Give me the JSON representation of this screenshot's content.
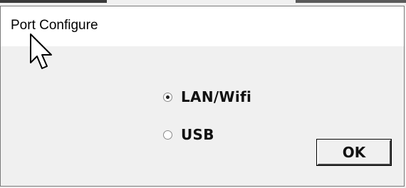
{
  "dialog": {
    "title": "Port Configure"
  },
  "options": {
    "lan_label": "LAN/Wifi",
    "usb_label": "USB",
    "selected": "LAN/Wifi"
  },
  "buttons": {
    "ok_label": "OK"
  },
  "icons": {
    "cursor": "arrow-cursor-icon"
  }
}
